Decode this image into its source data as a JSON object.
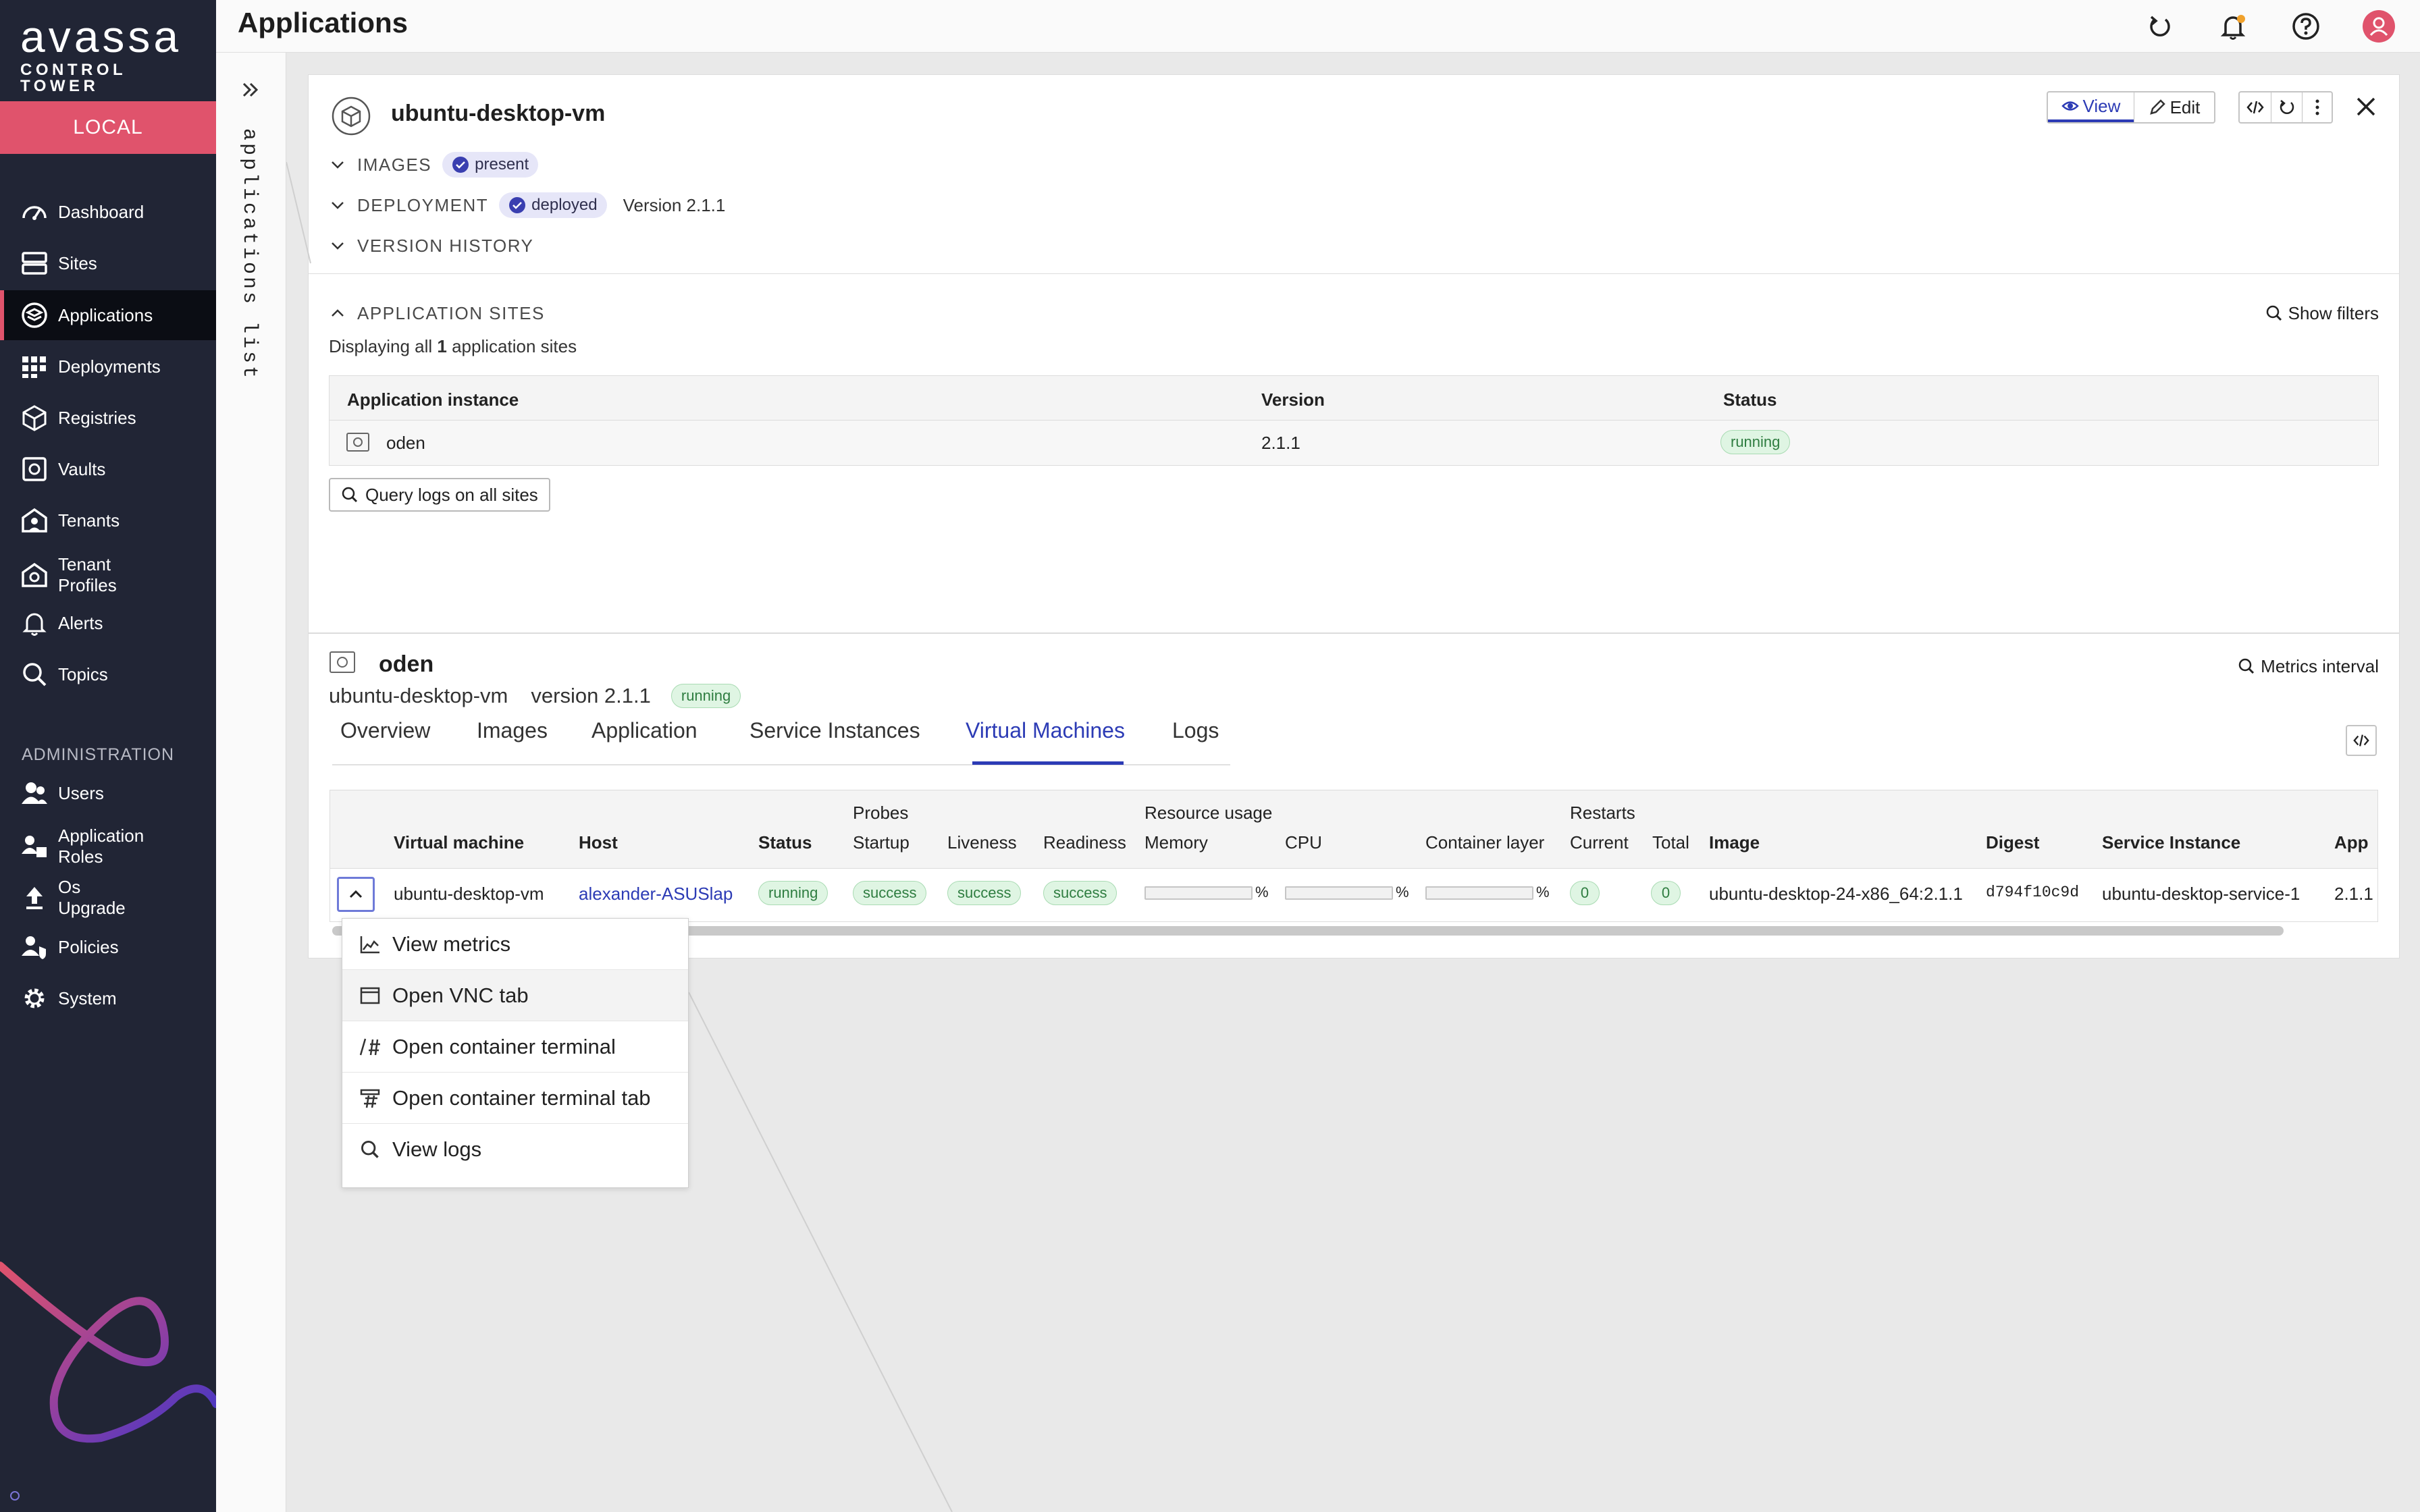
{
  "brand": {
    "name": "avassa",
    "product": "CONTROL TOWER",
    "environment": "LOCAL"
  },
  "sidebar": {
    "items": [
      {
        "label": "Dashboard",
        "icon": "dashboard-icon"
      },
      {
        "label": "Sites",
        "icon": "sites-icon"
      },
      {
        "label": "Applications",
        "icon": "applications-icon",
        "active": true
      },
      {
        "label": "Deployments",
        "icon": "deployments-icon"
      },
      {
        "label": "Registries",
        "icon": "registries-icon"
      },
      {
        "label": "Vaults",
        "icon": "vaults-icon"
      },
      {
        "label": "Tenants",
        "icon": "tenants-icon"
      },
      {
        "label": "Tenant Profiles",
        "line1": "Tenant",
        "line2": "Profiles",
        "icon": "tenant-profiles-icon"
      },
      {
        "label": "Alerts",
        "icon": "bell-icon"
      },
      {
        "label": "Topics",
        "icon": "search-icon"
      }
    ],
    "admin_heading": "ADMINISTRATION",
    "admin_items": [
      {
        "label": "Users",
        "icon": "users-icon"
      },
      {
        "label": "Application Roles",
        "line1": "Application",
        "line2": "Roles",
        "icon": "roles-icon"
      },
      {
        "label": "Os Upgrade",
        "line1": "Os",
        "line2": "Upgrade",
        "icon": "upgrade-icon"
      },
      {
        "label": "Policies",
        "icon": "policies-icon"
      },
      {
        "label": "System",
        "icon": "gear-icon"
      }
    ]
  },
  "list_rail": {
    "label": "applications list"
  },
  "topbar": {
    "title": "Applications",
    "icons": [
      "refresh-icon",
      "bell-icon",
      "help-icon",
      "user-icon"
    ],
    "accent": "#e0536c"
  },
  "app": {
    "name": "ubuntu-desktop-vm",
    "view_label": "View",
    "edit_label": "Edit",
    "sections": {
      "images_label": "IMAGES",
      "images_badge": "present",
      "deployment_label": "DEPLOYMENT",
      "deployment_badge": "deployed",
      "deployment_version": "Version 2.1.1",
      "history_label": "VERSION HISTORY"
    }
  },
  "sites": {
    "heading": "APPLICATION SITES",
    "show_filters": "Show filters",
    "count_prefix": "Displaying all ",
    "count_value": "1",
    "count_suffix": " application sites",
    "columns": [
      "Application instance",
      "Version",
      "Status"
    ],
    "rows": [
      {
        "instance": "oden",
        "version": "2.1.1",
        "status": "running"
      }
    ],
    "query_logs": "Query logs on all sites"
  },
  "site_detail": {
    "site": "oden",
    "app_name": "ubuntu-desktop-vm",
    "version": "version 2.1.1",
    "status": "running",
    "metrics_interval": "Metrics interval",
    "tabs": [
      "Overview",
      "Images",
      "Application",
      "Service Instances",
      "Virtual Machines",
      "Logs"
    ],
    "active_tab": "Virtual Machines",
    "group_headers": {
      "probes": "Probes",
      "resource_usage": "Resource usage",
      "restarts": "Restarts"
    },
    "columns": [
      "Virtual machine",
      "Host",
      "Status",
      "Startup",
      "Liveness",
      "Readiness",
      "Memory",
      "CPU",
      "Container layer",
      "Current",
      "Total",
      "Image",
      "Digest",
      "Service Instance",
      "App"
    ],
    "row": {
      "vm": "ubuntu-desktop-vm",
      "host": "alexander-ASUSlap",
      "status": "running",
      "startup": "success",
      "liveness": "success",
      "readiness": "success",
      "memory_pct_unit": "%",
      "memory_usage": 0,
      "cpu_pct_unit": "%",
      "cpu_usage": 0,
      "layer_pct_unit": "%",
      "layer_usage": 0,
      "restarts_current": "0",
      "restarts_total": "0",
      "image": "ubuntu-desktop-24-x86_64:2.1.1",
      "digest": "d794f10c9d",
      "service_instance": "ubuntu-desktop-service-1",
      "app_version": "2.1.1"
    }
  },
  "context_menu": {
    "items": [
      {
        "label": "View metrics",
        "icon": "chart-icon"
      },
      {
        "label": "Open VNC tab",
        "icon": "window-icon"
      },
      {
        "label": "Open container terminal",
        "icon": "terminal-icon"
      },
      {
        "label": "Open container terminal tab",
        "icon": "terminal-tab-icon"
      },
      {
        "label": "View logs",
        "icon": "search-icon"
      }
    ]
  }
}
